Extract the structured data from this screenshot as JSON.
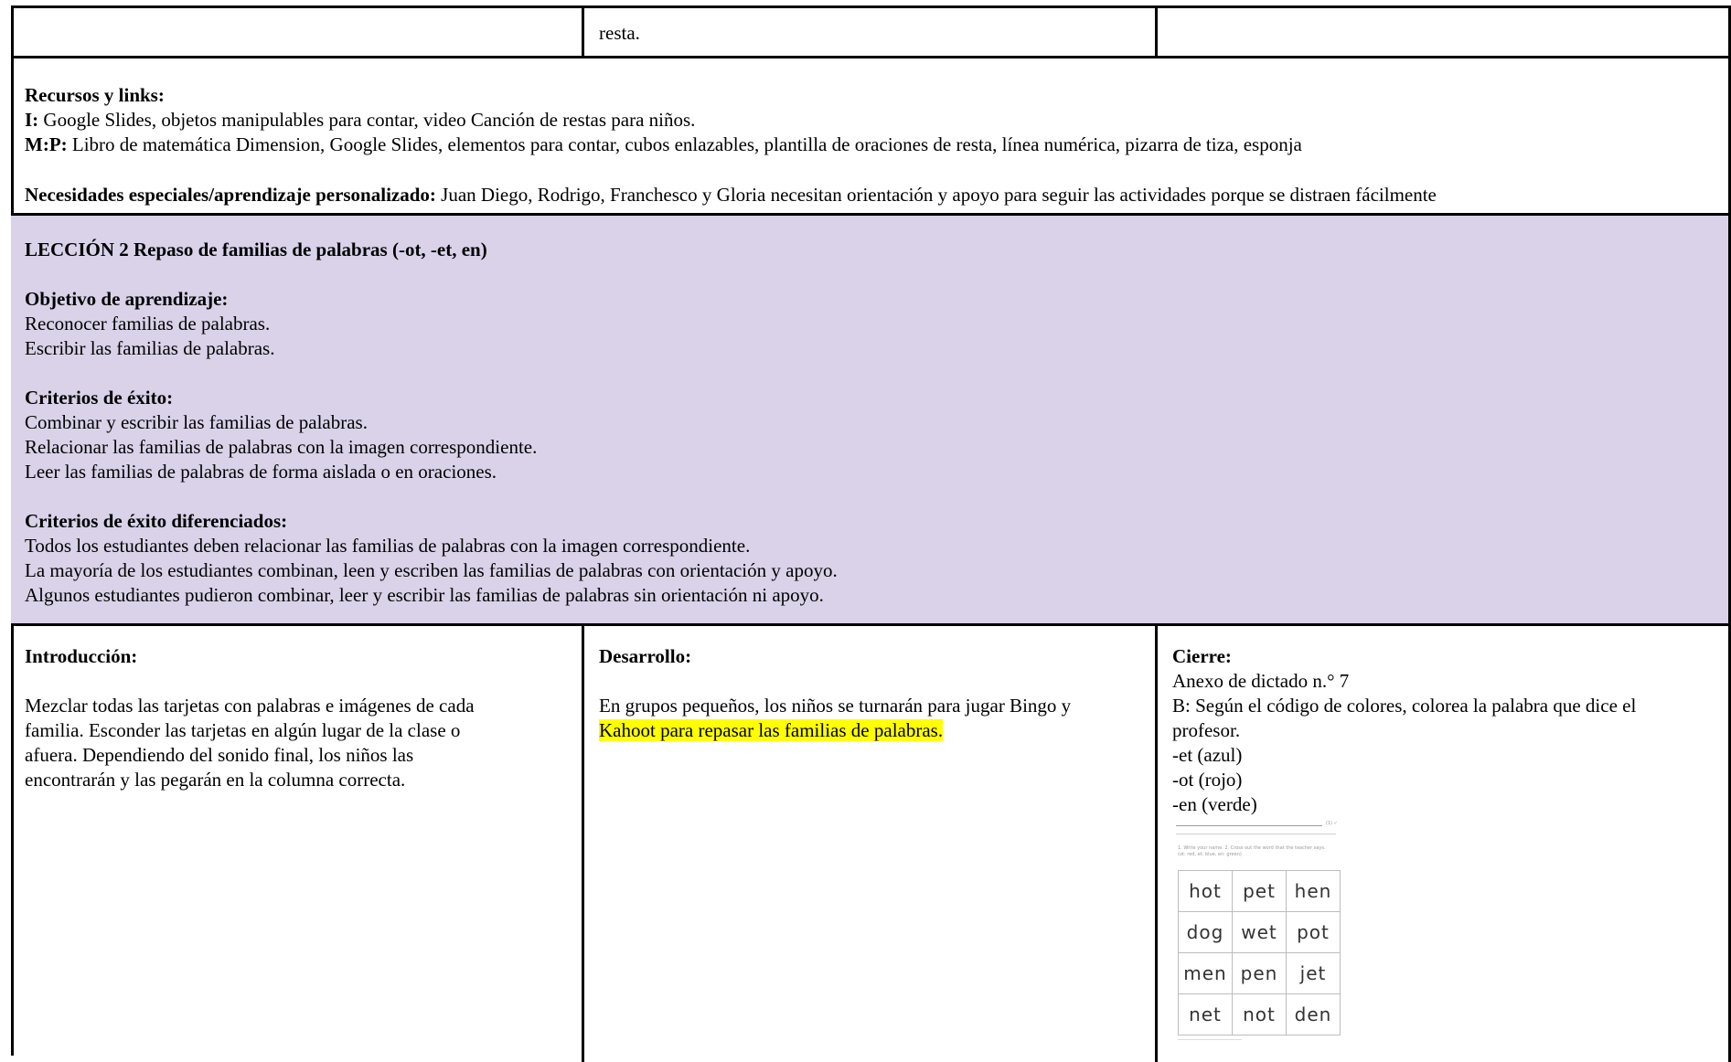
{
  "top_row": {
    "middle_text": "resta."
  },
  "resources": {
    "heading": "Recursos y links:",
    "i_label": "I:",
    "i_text": " Google Slides, objetos manipulables para contar, video Canción de restas para niños.",
    "mp_label": "M:P:",
    "mp_text": " Libro de matemática Dimension, Google Slides, elementos para contar, cubos enlazables, plantilla de oraciones de resta, línea numérica, pizarra de tiza, esponja",
    "special_label": "Necesidades especiales/aprendizaje personalizado:",
    "special_text": " Juan Diego, Rodrigo, Franchesco y Gloria necesitan orientación y apoyo para seguir las actividades porque se distraen fácilmente"
  },
  "lesson": {
    "title": "LECCIÓN 2 Repaso de familias de palabras (-ot, -et, en)",
    "objective_heading": "Objetivo de aprendizaje:",
    "objectives": [
      "Reconocer familias de palabras.",
      "Escribir las familias de palabras."
    ],
    "success_heading": "Criterios de éxito:",
    "success": [
      "Combinar y escribir las familias de palabras.",
      "Relacionar las familias de palabras con la imagen correspondiente.",
      "Leer las familias de palabras de forma aislada o en oraciones."
    ],
    "diff_heading": "Criterios de éxito diferenciados:",
    "diff": [
      "Todos los estudiantes deben relacionar las familias de palabras con la imagen correspondiente.",
      "La mayoría de los estudiantes combinan, leen y escriben las familias de palabras con orientación y apoyo.",
      "Algunos estudiantes pudieron combinar, leer y escribir las familias de palabras sin orientación ni apoyo."
    ]
  },
  "intro": {
    "heading": "Introducción:",
    "lines": [
      "Mezclar todas las tarjetas con palabras e imágenes de cada",
      "familia. Esconder las tarjetas en algún lugar de la clase o",
      "afuera. Dependiendo del sonido final, los niños las",
      "encontrarán y las pegarán en la columna correcta."
    ]
  },
  "development": {
    "heading": "Desarrollo:",
    "line1": "En grupos pequeños, los niños se turnarán para jugar Bingo y",
    "line2_highlight": "Kahoot para repasar las familias de palabras."
  },
  "closing": {
    "heading": "Cierre:",
    "lines": [
      "Anexo de dictado n.° 7",
      "B: Según el código de colores, colorea la palabra que dice el",
      "profesor.",
      "-et (azul)",
      "-ot (rojo)",
      "-en (verde)"
    ],
    "worksheet": {
      "instruction_1": "1. Write your name. 2. Cross out the word that the teacher says.",
      "instruction_2": "(ot: red, et: blue, en: green)",
      "words": [
        [
          "hot",
          "pet",
          "hen"
        ],
        [
          "dog",
          "wet",
          "pot"
        ],
        [
          "men",
          "pen",
          "jet"
        ],
        [
          "net",
          "not",
          "den"
        ]
      ]
    }
  }
}
